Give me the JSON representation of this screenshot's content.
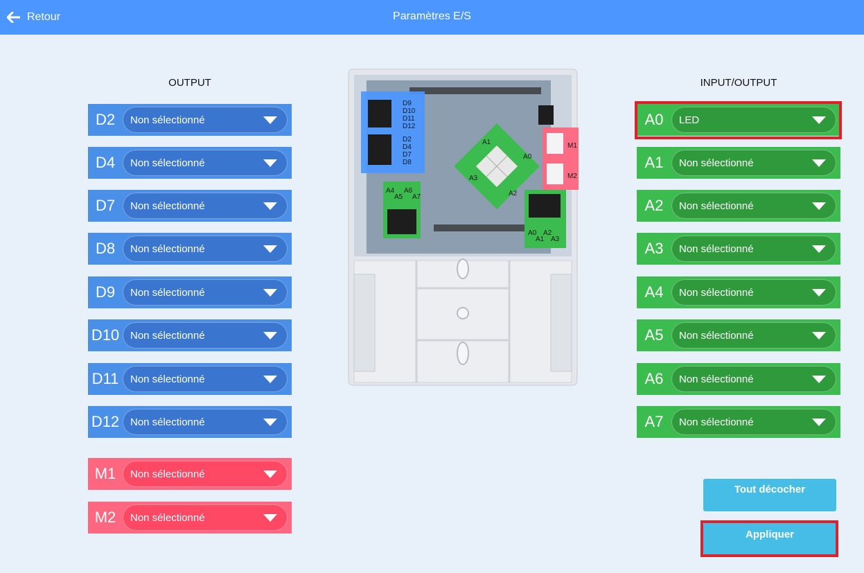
{
  "header": {
    "back_label": "Retour",
    "title": "Paramètres E/S",
    "color": "#4c97ff"
  },
  "output": {
    "heading": "OUTPUT",
    "pins": [
      {
        "label": "D2",
        "value": "Non sélectionné"
      },
      {
        "label": "D4",
        "value": "Non sélectionné"
      },
      {
        "label": "D7",
        "value": "Non sélectionné"
      },
      {
        "label": "D8",
        "value": "Non sélectionné"
      },
      {
        "label": "D9",
        "value": "Non sélectionné"
      },
      {
        "label": "D10",
        "value": "Non sélectionné"
      },
      {
        "label": "D11",
        "value": "Non sélectionné"
      },
      {
        "label": "D12",
        "value": "Non sélectionné"
      }
    ],
    "motors": [
      {
        "label": "M1",
        "value": "Non sélectionné"
      },
      {
        "label": "M2",
        "value": "Non sélectionné"
      }
    ]
  },
  "input_output": {
    "heading": "INPUT/OUTPUT",
    "pins": [
      {
        "label": "A0",
        "value": "LED"
      },
      {
        "label": "A1",
        "value": "Non sélectionné"
      },
      {
        "label": "A2",
        "value": "Non sélectionné"
      },
      {
        "label": "A3",
        "value": "Non sélectionné"
      },
      {
        "label": "A4",
        "value": "Non sélectionné"
      },
      {
        "label": "A5",
        "value": "Non sélectionné"
      },
      {
        "label": "A6",
        "value": "Non sélectionné"
      },
      {
        "label": "A7",
        "value": "Non sélectionné"
      }
    ]
  },
  "board": {
    "digital_top": [
      "D9",
      "D10",
      "D11",
      "D12"
    ],
    "digital_bottom": [
      "D2",
      "D4",
      "D7",
      "D8"
    ],
    "motor_labels": [
      "M1",
      "M2"
    ],
    "diamond_labels": [
      "A1",
      "A0",
      "A3",
      "A2"
    ],
    "left_header": [
      "A4",
      "A6",
      "A5",
      "A7"
    ],
    "right_header": [
      "A0",
      "A2",
      "A1",
      "A3"
    ]
  },
  "actions": {
    "uncheck_all_label": "Tout décocher",
    "apply_label": "Appliquer"
  },
  "colors": {
    "digital": "#4a90e8",
    "motor": "#ff6680",
    "analog": "#3cbc4f",
    "button": "#46bde6",
    "highlight": "#e0202b"
  }
}
